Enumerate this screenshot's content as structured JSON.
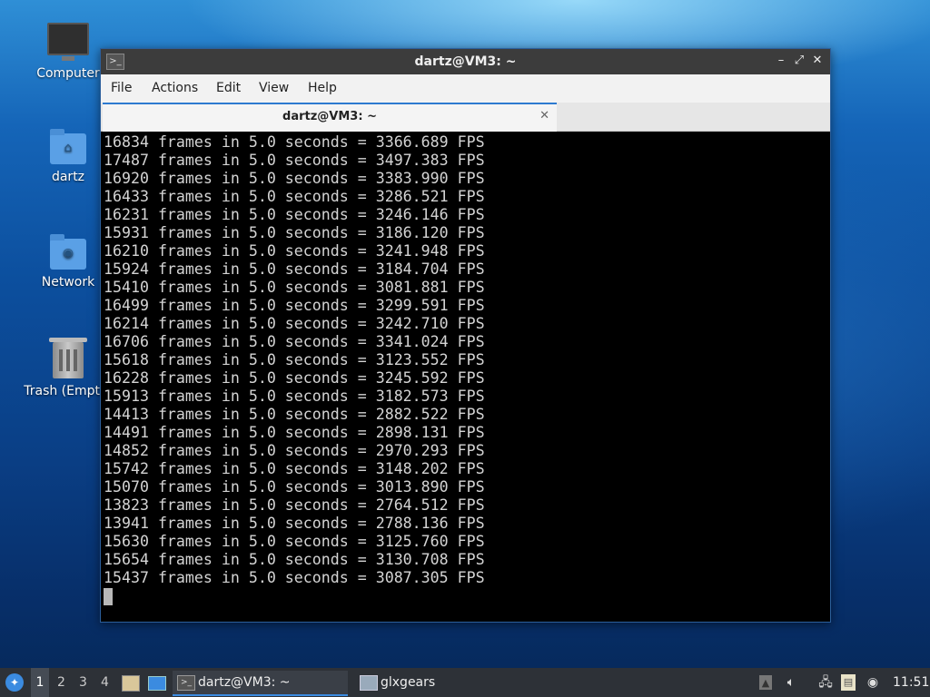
{
  "desktop": {
    "icons": [
      {
        "label": "Computer"
      },
      {
        "label": "dartz"
      },
      {
        "label": "Network"
      },
      {
        "label": "Trash (Empty)"
      }
    ]
  },
  "window": {
    "title": "dartz@VM3: ~",
    "menu": [
      "File",
      "Actions",
      "Edit",
      "View",
      "Help"
    ],
    "tab_label": "dartz@VM3: ~",
    "terminal_lines": [
      "16834 frames in 5.0 seconds = 3366.689 FPS",
      "17487 frames in 5.0 seconds = 3497.383 FPS",
      "16920 frames in 5.0 seconds = 3383.990 FPS",
      "16433 frames in 5.0 seconds = 3286.521 FPS",
      "16231 frames in 5.0 seconds = 3246.146 FPS",
      "15931 frames in 5.0 seconds = 3186.120 FPS",
      "16210 frames in 5.0 seconds = 3241.948 FPS",
      "15924 frames in 5.0 seconds = 3184.704 FPS",
      "15410 frames in 5.0 seconds = 3081.881 FPS",
      "16499 frames in 5.0 seconds = 3299.591 FPS",
      "16214 frames in 5.0 seconds = 3242.710 FPS",
      "16706 frames in 5.0 seconds = 3341.024 FPS",
      "15618 frames in 5.0 seconds = 3123.552 FPS",
      "16228 frames in 5.0 seconds = 3245.592 FPS",
      "15913 frames in 5.0 seconds = 3182.573 FPS",
      "14413 frames in 5.0 seconds = 2882.522 FPS",
      "14491 frames in 5.0 seconds = 2898.131 FPS",
      "14852 frames in 5.0 seconds = 2970.293 FPS",
      "15742 frames in 5.0 seconds = 3148.202 FPS",
      "15070 frames in 5.0 seconds = 3013.890 FPS",
      "13823 frames in 5.0 seconds = 2764.512 FPS",
      "13941 frames in 5.0 seconds = 2788.136 FPS",
      "15630 frames in 5.0 seconds = 3125.760 FPS",
      "15654 frames in 5.0 seconds = 3130.708 FPS",
      "15437 frames in 5.0 seconds = 3087.305 FPS"
    ]
  },
  "taskbar": {
    "workspaces": [
      "1",
      "2",
      "3",
      "4"
    ],
    "tasks": [
      {
        "label": "dartz@VM3: ~",
        "icon": "terminal-icon"
      },
      {
        "label": "glxgears",
        "icon": "window-icon"
      }
    ],
    "clock": "11:51"
  },
  "colors": {
    "window_border": "#2b5f9c",
    "titlebar": "#3c3c3c",
    "terminal_bg": "#000000",
    "terminal_fg": "#d4d4d4",
    "taskbar": "#2d3137",
    "accent": "#2d7ad0"
  }
}
